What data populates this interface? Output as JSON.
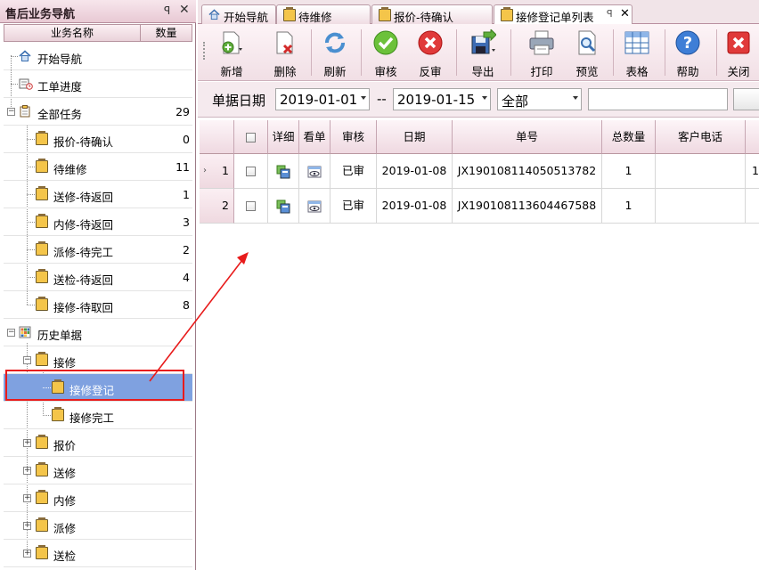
{
  "nav": {
    "title": "售后业务导航",
    "pin": "ꟼ",
    "close": "✕",
    "col_name": "业务名称",
    "col_count": "数量",
    "items": [
      {
        "label": "开始导航",
        "count": ""
      },
      {
        "label": "工单进度",
        "count": ""
      },
      {
        "label": "全部任务",
        "count": "29"
      },
      {
        "label": "报价-待确认",
        "count": "0"
      },
      {
        "label": "待维修",
        "count": "11"
      },
      {
        "label": "送修-待返回",
        "count": "1"
      },
      {
        "label": "内修-待返回",
        "count": "3"
      },
      {
        "label": "派修-待完工",
        "count": "2"
      },
      {
        "label": "送检-待返回",
        "count": "4"
      },
      {
        "label": "接修-待取回",
        "count": "8"
      },
      {
        "label": "历史单据",
        "count": ""
      },
      {
        "label": "接修",
        "count": ""
      },
      {
        "label": "接修登记",
        "count": ""
      },
      {
        "label": "接修完工",
        "count": ""
      },
      {
        "label": "报价",
        "count": ""
      },
      {
        "label": "送修",
        "count": ""
      },
      {
        "label": "内修",
        "count": ""
      },
      {
        "label": "派修",
        "count": ""
      },
      {
        "label": "送检",
        "count": ""
      }
    ]
  },
  "tabs": [
    {
      "label": "开始导航"
    },
    {
      "label": "待维修"
    },
    {
      "label": "报价-待确认"
    },
    {
      "label": "接修登记单列表",
      "active": true
    }
  ],
  "tab_pin": "ꟼ",
  "tab_close": "✕",
  "toolbar": {
    "buttons": [
      {
        "label": "新增",
        "icon": "new-doc-icon"
      },
      {
        "label": "删除",
        "icon": "delete-doc-icon"
      },
      {
        "label": "刷新",
        "icon": "refresh-icon"
      },
      {
        "label": "审核",
        "icon": "check-icon"
      },
      {
        "label": "反审",
        "icon": "cancel-icon"
      },
      {
        "label": "导出",
        "icon": "export-icon"
      },
      {
        "label": "打印",
        "icon": "printer-icon"
      },
      {
        "label": "预览",
        "icon": "preview-icon"
      },
      {
        "label": "表格",
        "icon": "table-icon"
      },
      {
        "label": "帮助",
        "icon": "help-icon"
      },
      {
        "label": "关闭",
        "icon": "close-icon"
      }
    ]
  },
  "filter": {
    "label": "单据日期",
    "date_from": "2019-01-01",
    "separator": "--",
    "date_to": "2019-01-15",
    "status": "全部",
    "search": ""
  },
  "grid": {
    "headers": [
      "",
      "",
      "详细",
      "看单",
      "审核",
      "日期",
      "单号",
      "总数量",
      "客户电话"
    ],
    "rows": [
      {
        "no": "1",
        "status": "已审",
        "date": "2019-01-08",
        "doc_no": "JX190108114050513782",
        "qty": "1",
        "phone": "",
        "extra": "1"
      },
      {
        "no": "2",
        "status": "已审",
        "date": "2019-01-08",
        "doc_no": "JX190108113604467588",
        "qty": "1",
        "phone": "",
        "extra": ""
      }
    ]
  },
  "colors": {
    "accent": "#e81b1b",
    "selected_row": "#7fa1e0",
    "header_bg": "#f1dfe5"
  }
}
